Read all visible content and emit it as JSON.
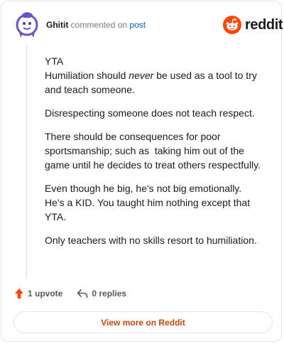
{
  "header": {
    "username": "Ghitit",
    "action_text": "commented on",
    "post_link": "post",
    "logo_text": "reddit"
  },
  "comment": {
    "p1_line1": "YTA",
    "p1_line2_before": "Humiliation should ",
    "p1_line2_em": "never",
    "p1_line2_after": " be used as a tool to try",
    "p1_line3": "and teach someone.",
    "p2": "Disrespecting someone does not teach respect.",
    "p3_line1": "There should be consequences for poor",
    "p3_line2": "sportsmanship; such as  taking him out of the",
    "p3_line3": "game until he decides to treat others respectfully.",
    "p4_line1": "Even though he big, he's not big emotionally.",
    "p4_line2": "He's a KID. You taught him nothing except that",
    "p4_line3": "YTA.",
    "p5": "Only teachers with no skills resort to humiliation."
  },
  "actions": {
    "upvote_icon": "upvote-arrow-icon",
    "upvote_label": "1 upvote",
    "reply_icon": "reply-arrow-icon",
    "replies_label": "0 replies"
  },
  "footer": {
    "view_label": "View more on Reddit"
  },
  "colors": {
    "brand": "#ff4500",
    "link": "#0f5ea8",
    "button_text": "#c8430a"
  }
}
